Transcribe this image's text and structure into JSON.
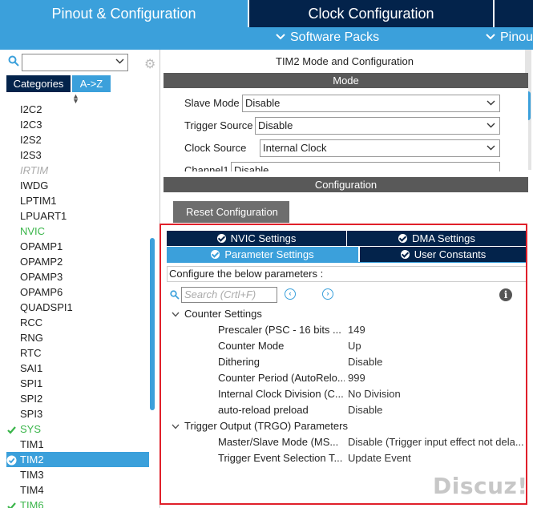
{
  "header": {
    "tabs": [
      {
        "label": "Pinout & Configuration",
        "active": true
      },
      {
        "label": "Clock Configuration",
        "active": false
      }
    ],
    "submenu": {
      "software_packs": "Software Packs",
      "pinout": "Pinou"
    }
  },
  "sidebar": {
    "search_value": "",
    "category_tabs": [
      "Categories",
      "A->Z"
    ],
    "items": [
      {
        "label": "I2C2",
        "state": "normal"
      },
      {
        "label": "I2C3",
        "state": "normal"
      },
      {
        "label": "I2S2",
        "state": "normal"
      },
      {
        "label": "I2S3",
        "state": "normal"
      },
      {
        "label": "IRTIM",
        "state": "disabled"
      },
      {
        "label": "IWDG",
        "state": "normal"
      },
      {
        "label": "LPTIM1",
        "state": "normal"
      },
      {
        "label": "LPUART1",
        "state": "normal"
      },
      {
        "label": "NVIC",
        "state": "configured"
      },
      {
        "label": "OPAMP1",
        "state": "normal"
      },
      {
        "label": "OPAMP2",
        "state": "normal"
      },
      {
        "label": "OPAMP3",
        "state": "normal"
      },
      {
        "label": "OPAMP6",
        "state": "normal"
      },
      {
        "label": "QUADSPI1",
        "state": "normal"
      },
      {
        "label": "RCC",
        "state": "normal"
      },
      {
        "label": "RNG",
        "state": "normal"
      },
      {
        "label": "RTC",
        "state": "normal"
      },
      {
        "label": "SAI1",
        "state": "normal"
      },
      {
        "label": "SPI1",
        "state": "normal"
      },
      {
        "label": "SPI2",
        "state": "normal"
      },
      {
        "label": "SPI3",
        "state": "normal"
      },
      {
        "label": "SYS",
        "state": "checked"
      },
      {
        "label": "TIM1",
        "state": "normal"
      },
      {
        "label": "TIM2",
        "state": "selected"
      },
      {
        "label": "TIM3",
        "state": "normal"
      },
      {
        "label": "TIM4",
        "state": "normal"
      },
      {
        "label": "TIM6",
        "state": "checked"
      }
    ]
  },
  "main": {
    "title": "TIM2 Mode and Configuration",
    "mode_header": "Mode",
    "mode_fields": [
      {
        "label": "Slave Mode",
        "value": "Disable"
      },
      {
        "label": "Trigger Source",
        "value": "Disable"
      },
      {
        "label": "Clock Source",
        "value": "Internal Clock"
      },
      {
        "label": "Channel1",
        "value": "Disable"
      }
    ],
    "config_header": "Configuration",
    "reset_label": "Reset Configuration",
    "sub_tabs": [
      {
        "label": "NVIC Settings",
        "active": false
      },
      {
        "label": "DMA Settings",
        "active": false
      },
      {
        "label": "Parameter Settings",
        "active": true
      },
      {
        "label": "User Constants",
        "active": false
      }
    ],
    "configure_text": "Configure the below parameters :",
    "search_placeholder": "Search (Crtl+F)",
    "groups": [
      {
        "name": "Counter Settings",
        "params": [
          {
            "key": "Prescaler (PSC - 16 bits ...",
            "value": "149"
          },
          {
            "key": "Counter Mode",
            "value": "Up"
          },
          {
            "key": "Dithering",
            "value": "Disable"
          },
          {
            "key": "Counter Period (AutoRelo...",
            "value": "999"
          },
          {
            "key": "Internal Clock Division (C...",
            "value": "No Division"
          },
          {
            "key": "auto-reload preload",
            "value": "Disable"
          }
        ]
      },
      {
        "name": "Trigger Output (TRGO) Parameters",
        "params": [
          {
            "key": "Master/Slave Mode (MS...",
            "value": "Disable (Trigger input effect not dela..."
          },
          {
            "key": "Trigger Event Selection T...",
            "value": "Update Event"
          }
        ]
      }
    ]
  },
  "watermark": "Discuz!",
  "colors": {
    "light_blue": "#3ba0db",
    "dark_navy": "#03234b",
    "green": "#3ab54a",
    "red_frame": "#e0202a",
    "gray_bar": "#595959"
  }
}
